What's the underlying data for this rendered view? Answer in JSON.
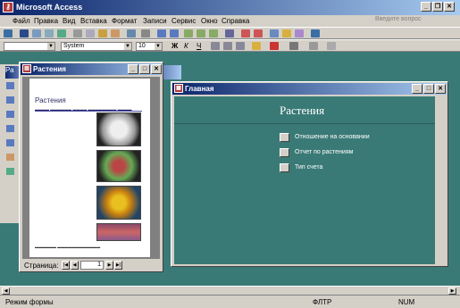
{
  "app": {
    "title": "Microsoft Access"
  },
  "menu": {
    "items": [
      "Файл",
      "Правка",
      "Вид",
      "Вставка",
      "Формат",
      "Записи",
      "Сервис",
      "Окно",
      "Справка"
    ],
    "ask_placeholder": "Введите вопрос"
  },
  "format_toolbar": {
    "object_combo": "",
    "font_name": "System",
    "font_size": "10",
    "bold": "Ж",
    "italic": "К",
    "underline": "Ч"
  },
  "preview_window": {
    "title": "Растения",
    "page_title": "Растения",
    "nav_label": "Страница:",
    "page_number": "1"
  },
  "switchboard": {
    "title": "Главная",
    "heading": "Растения",
    "items": [
      {
        "label": "Отношение на основании"
      },
      {
        "label": "Отчет по растениям"
      },
      {
        "label": "Тип счета"
      }
    ]
  },
  "db_window_stub": "Ра",
  "status": {
    "left": "Режим формы",
    "middle": "ФЛТР",
    "right": "NUM"
  },
  "colors": {
    "mdi_bg": "#3a7a76",
    "titlebar": "#0a246a",
    "chrome": "#d4d0c8"
  }
}
